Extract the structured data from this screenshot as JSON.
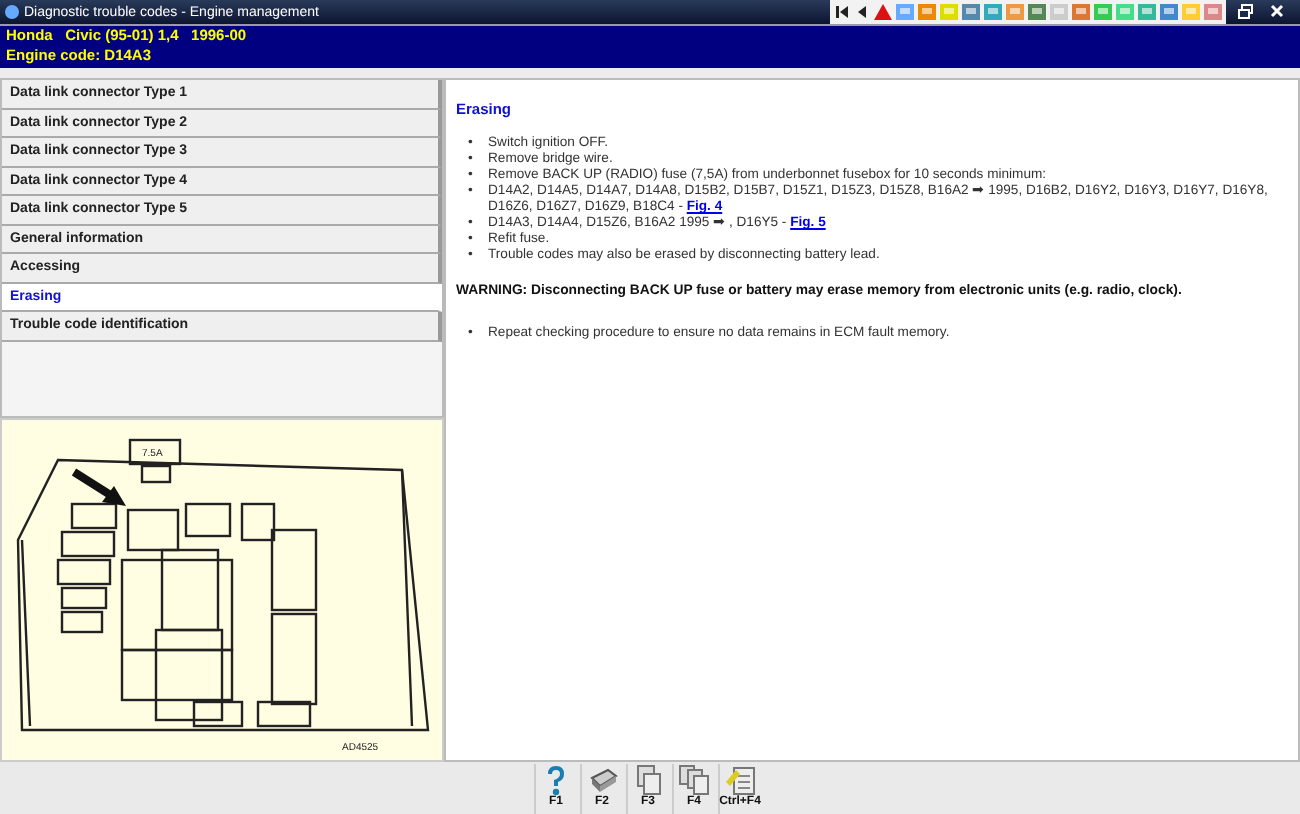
{
  "window": {
    "title": "Diagnostic trouble codes - Engine management"
  },
  "header": {
    "lines": [
      "Honda   Civic (95-01) 1,4   1996-00",
      "Engine code: D14A3"
    ]
  },
  "sidebar": {
    "items": [
      {
        "label": "Data link connector  Type 1",
        "selected": false
      },
      {
        "label": "Data link connector  Type 2",
        "selected": false
      },
      {
        "label": "Data link connector  Type 3",
        "selected": false
      },
      {
        "label": "Data link connector  Type 4",
        "selected": false
      },
      {
        "label": "Data link connector  Type 5",
        "selected": false
      },
      {
        "label": "General information",
        "selected": false
      },
      {
        "label": "Accessing",
        "selected": false
      },
      {
        "label": "Erasing",
        "selected": true
      },
      {
        "label": "Trouble code identification",
        "selected": false
      }
    ]
  },
  "figure": {
    "fuse_label": "7.5A",
    "code": "AD4525"
  },
  "content": {
    "heading": "Erasing",
    "steps": [
      {
        "marker": "•",
        "text": "Switch ignition OFF."
      },
      {
        "marker": "•",
        "text": "Remove bridge wire."
      },
      {
        "marker": "•",
        "text": "Remove BACK UP (RADIO) fuse (7,5A) from underbonnet fusebox for 10 seconds minimum:"
      },
      {
        "marker": "•",
        "text": "D14A2, D14A5, D14A7, D14A8, D15B2, D15B7, D15Z1, D15Z3, D15Z8, B16A2 ➡ 1995, D16B2, D16Y2, D16Y3, D16Y7, D16Y8, D16Z6, D16Z7, D16Z9, B18C4 - ",
        "link": "Fig. 4"
      },
      {
        "marker": "•",
        "text": "D14A3, D14A4, D15Z6, B16A2 1995 ➡ , D16Y5 - ",
        "link": "Fig. 5"
      },
      {
        "marker": "•",
        "text": "Refit fuse."
      },
      {
        "marker": "•",
        "text": "Trouble codes may also be erased by disconnecting battery lead."
      }
    ],
    "warning": "WARNING: Disconnecting BACK UP fuse or battery may erase memory from electronic units (e.g. radio, clock).",
    "final_steps": [
      {
        "marker": "•",
        "text": "Repeat checking procedure to ensure no data remains in ECM fault memory."
      }
    ]
  },
  "footer": {
    "buttons": [
      {
        "kind": "help",
        "key": "F1"
      },
      {
        "kind": "print",
        "key": "F2"
      },
      {
        "kind": "copy",
        "key": "F3"
      },
      {
        "kind": "copyall",
        "key": "F4"
      },
      {
        "kind": "note",
        "key": "Ctrl+F4"
      }
    ]
  }
}
